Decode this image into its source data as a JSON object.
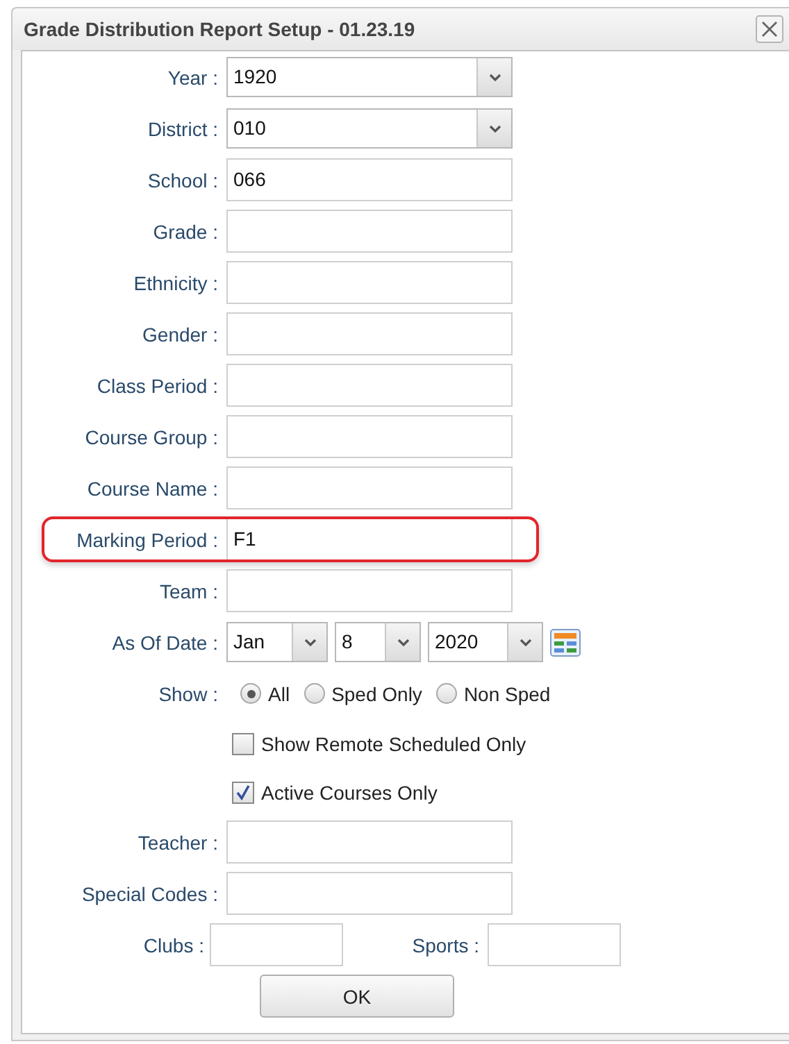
{
  "window": {
    "title": "Grade Distribution Report Setup - 01.23.19"
  },
  "fields": [
    {
      "kind": "select",
      "label": "Year :",
      "value": "1920"
    },
    {
      "kind": "select",
      "label": "District :",
      "value": "010"
    },
    {
      "kind": "text",
      "label": "School :",
      "value": "066"
    },
    {
      "kind": "text",
      "label": "Grade :"
    },
    {
      "kind": "text",
      "label": "Ethnicity :"
    },
    {
      "kind": "text",
      "label": "Gender :"
    },
    {
      "kind": "text",
      "label": "Class Period :"
    },
    {
      "kind": "text",
      "label": "Course Group :"
    },
    {
      "kind": "text",
      "label": "Course Name :"
    },
    {
      "kind": "text",
      "label": "Marking Period :",
      "value": "F1",
      "highlighted": true
    },
    {
      "kind": "text",
      "label": "Team :"
    },
    {
      "kind": "date",
      "label": "As Of Date :",
      "parts": [
        "Jan",
        "8",
        "2020"
      ]
    },
    {
      "kind": "radio",
      "label": "Show :",
      "options": [
        {
          "label": "All",
          "selected": true
        },
        {
          "label": "Sped Only",
          "selected": false
        },
        {
          "label": "Non Sped",
          "selected": false
        }
      ]
    },
    {
      "kind": "checkbox",
      "label": "Show Remote Scheduled Only",
      "checked": false
    },
    {
      "kind": "checkbox",
      "label": "Active Courses Only",
      "checked": true
    },
    {
      "kind": "text",
      "label": "Teacher :"
    },
    {
      "kind": "text",
      "label": "Special Codes :"
    },
    {
      "kind": "pair",
      "items": [
        {
          "label": "Clubs :"
        },
        {
          "label": "Sports :"
        }
      ]
    }
  ],
  "buttons": [
    "OK"
  ]
}
